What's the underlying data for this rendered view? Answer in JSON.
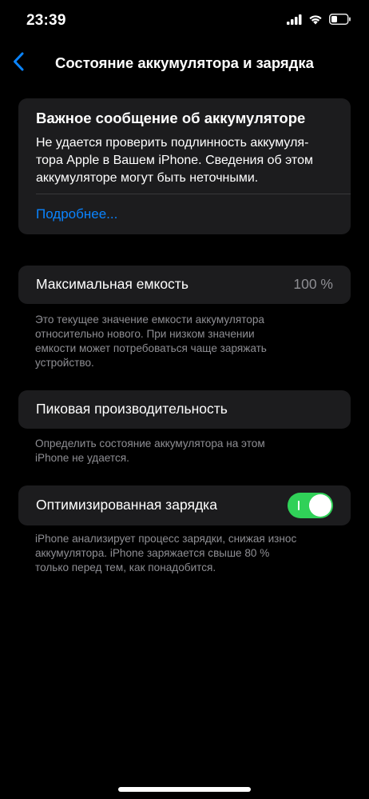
{
  "status_bar": {
    "time": "23:39",
    "icons": [
      "cellular-signal-icon",
      "wifi-icon",
      "battery-icon"
    ]
  },
  "nav": {
    "back_icon": "chevron-left-icon",
    "title": "Состояние аккумулятора и зарядка"
  },
  "alert_card": {
    "title": "Важное сообщение об аккумуляторе",
    "body_lines": [
      "Не удается проверить подлинность аккумуля-",
      "тора Apple в Вашем iPhone. Сведения об этом",
      "аккумуляторе могут быть неточными."
    ],
    "link": "Подробнее..."
  },
  "max_capacity": {
    "label": "Максимальная емкость",
    "value": "100 %",
    "footnote_lines": [
      "Это текущее значение емкости аккумулятора",
      "относительно нового. При низком значении",
      "емкости может потребоваться чаще заряжать",
      "устройство."
    ]
  },
  "peak_performance": {
    "label": "Пиковая производительность",
    "footnote_lines": [
      "Определить состояние аккумулятора на этом",
      "iPhone не удается."
    ]
  },
  "optimized_charging": {
    "label": "Оптимизированная зарядка",
    "enabled": true,
    "footnote_lines": [
      "iPhone анализирует процесс зарядки, снижая износ",
      "аккумулятора. iPhone заряжается свыше 80 %",
      "только перед тем, как понадобится."
    ]
  },
  "colors": {
    "background": "#000000",
    "card": "#1c1c1e",
    "accent": "#0a84ff",
    "toggle_on": "#30d158",
    "secondary_text": "#8e8e93"
  }
}
